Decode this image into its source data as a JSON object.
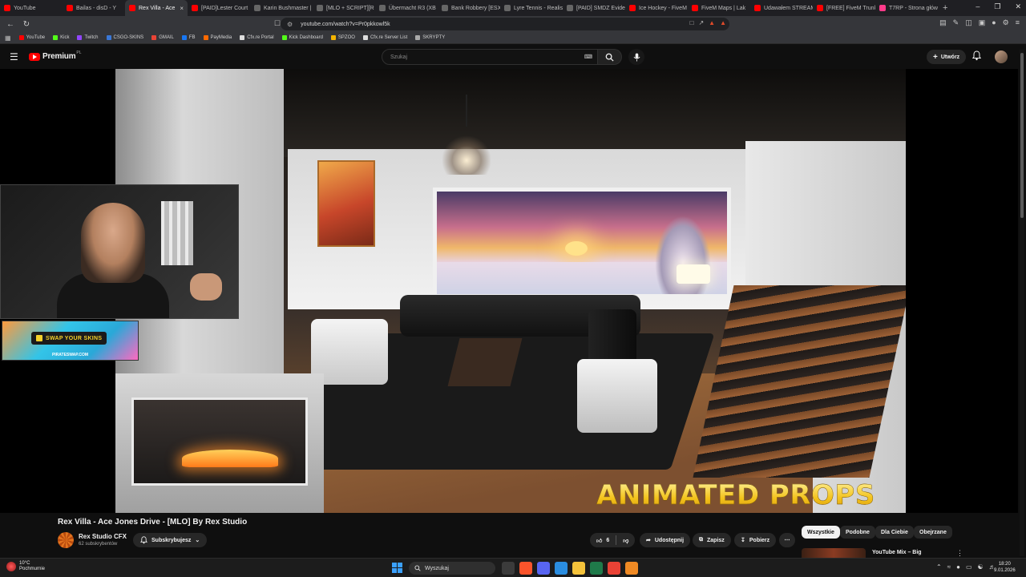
{
  "browser": {
    "tabs": [
      {
        "label": "YouTube",
        "color": "#ff0000"
      },
      {
        "label": "Bailas - disD - Y",
        "color": "#ff0000"
      },
      {
        "label": "Rex Villa - Ace",
        "color": "#ff0000",
        "active": true
      },
      {
        "label": "[PAID]Lester Court ",
        "color": "#ff0000"
      },
      {
        "label": "Karin Bushmaster |",
        "color": "#666666"
      },
      {
        "label": "[MLO + SCRIPT][R",
        "color": "#666666"
      },
      {
        "label": "Übermacht R3 (XB",
        "color": "#666666"
      },
      {
        "label": "Bank Robbery [ESX",
        "color": "#666666"
      },
      {
        "label": "Lyre Tennis - Realis",
        "color": "#666666"
      },
      {
        "label": "[PAID] SMDZ Evide",
        "color": "#666666"
      },
      {
        "label": "Ice Hockey - FiveM",
        "color": "#ff0000"
      },
      {
        "label": "FiveM Maps | Lak",
        "color": "#ff0000"
      },
      {
        "label": "Udawałem STREAM",
        "color": "#ff0000"
      },
      {
        "label": "[FREE] FiveM Trunk",
        "color": "#ff0000"
      },
      {
        "label": "T7RP - Strona głów",
        "color": "#ff3b8b"
      }
    ],
    "url": "youtube.com/watch?v=Pr0pkkowl5k",
    "bookmarks": [
      {
        "label": "YouTube",
        "color": "#ff0000"
      },
      {
        "label": "Kick",
        "color": "#53fc18"
      },
      {
        "label": "Twitch",
        "color": "#9146ff"
      },
      {
        "label": "CSGO-SKINS",
        "color": "#3a78d8"
      },
      {
        "label": "GMAIL",
        "color": "#ea4335"
      },
      {
        "label": "FB",
        "color": "#1877f2"
      },
      {
        "label": "PayMedia",
        "color": "#ff6a00"
      },
      {
        "label": "Cfx.re Portal",
        "color": "#dddddd"
      },
      {
        "label": "Kick Dashboard",
        "color": "#53fc18"
      },
      {
        "label": "SPZOO",
        "color": "#f5b400"
      },
      {
        "label": "Cfx.re Server List",
        "color": "#dddddd"
      },
      {
        "label": "SKRYPTY",
        "color": "#aaaaaa"
      }
    ]
  },
  "youtube": {
    "logo_text": "Premium",
    "logo_region": "PL",
    "search_placeholder": "Szukaj",
    "create_label": "Utwórz"
  },
  "video": {
    "overlay_text": "ANIMATED PROPS",
    "ad_text": "SWAP YOUR SKINS",
    "ad_url": "PIRATESWAP.COM",
    "title": "Rex Villa - Ace Jones Drive - [MLO] By Rex Studio",
    "channel": "Rex Studio CFX",
    "subscribers": "62 subskrybentów",
    "subscribe_label": "Subskrybujesz",
    "likes": "6",
    "share_label": "Udostępnij",
    "save_label": "Zapisz",
    "download_label": "Pobierz"
  },
  "sidebar": {
    "chips": [
      "Wszystkie",
      "Podobne",
      "Dla Ciebie",
      "Obejrzane"
    ],
    "active_chip": 0,
    "next_title": "YouTube Mix – Big"
  },
  "taskbar": {
    "temperature": "10°C",
    "weather": "Pochmurnie",
    "search_label": "Wyszukaj",
    "time": "18:20",
    "date": "9.01.2026"
  }
}
